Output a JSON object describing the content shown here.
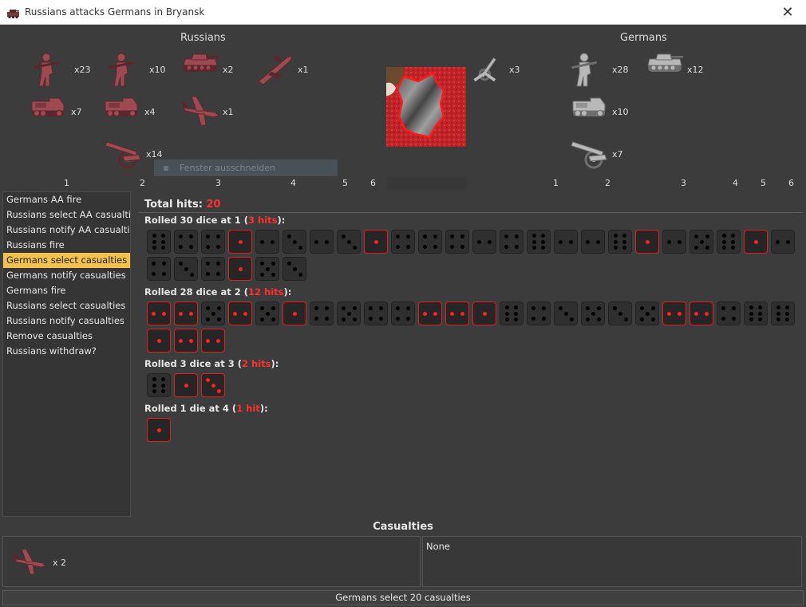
{
  "window": {
    "title": "Russians attacks Germans in Bryansk",
    "close_glyph": "✕"
  },
  "attacker": {
    "name": "Russians",
    "units": [
      {
        "icon": "infantry-icon",
        "count": "x23"
      },
      {
        "icon": "infantry-icon",
        "count": "x10"
      },
      {
        "icon": "tank-icon",
        "count": "x2"
      },
      {
        "icon": "bomber-icon",
        "count": "x1"
      },
      {
        "icon": "halftrack-icon",
        "count": "x7"
      },
      {
        "icon": "halftrack-icon",
        "count": "x4"
      },
      {
        "icon": "fighter-icon",
        "count": "x1"
      },
      {
        "icon": "artillery-icon",
        "count": "x14"
      }
    ],
    "axis": [
      "1",
      "2",
      "3",
      "4",
      "5",
      "6"
    ]
  },
  "defender": {
    "name": "Germans",
    "aa_unit": {
      "icon": "aa-gun-icon",
      "count": "x3"
    },
    "units": [
      {
        "icon": "infantry-icon",
        "count": "x28"
      },
      {
        "icon": "tank-icon",
        "count": "x12"
      },
      {
        "icon": "halftrack-icon",
        "count": "x10"
      },
      {
        "icon": "artillery-icon",
        "count": "x7"
      }
    ],
    "axis": [
      "1",
      "2",
      "3",
      "4",
      "5",
      "6"
    ]
  },
  "ghost_menu": "Fenster ausschneiden",
  "steps": [
    "Germans AA fire",
    "Russians select AA casualties",
    "Russians notify AA casualties",
    "Russians fire",
    "Germans select casualties",
    "Germans notify casualties",
    "Germans fire",
    "Russians select casualties",
    "Russians notify casualties",
    "Remove casualties",
    "Russians withdraw?"
  ],
  "selected_step": 4,
  "total": {
    "label": "Total hits:",
    "value": "20"
  },
  "rolls": [
    {
      "prefix": "Rolled 30 dice at 1 (",
      "hits": "3 hits",
      "suffix": "):",
      "threshold": 1,
      "dice": [
        6,
        4,
        4,
        1,
        2,
        3,
        2,
        3,
        1,
        4,
        4,
        4,
        2,
        4,
        6,
        2,
        2,
        6,
        1,
        2,
        5,
        6,
        1,
        2,
        4,
        3,
        4,
        1,
        5,
        3
      ]
    },
    {
      "prefix": "Rolled 28 dice at 2 (",
      "hits": "12 hits",
      "suffix": "):",
      "threshold": 2,
      "dice": [
        2,
        2,
        5,
        2,
        5,
        1,
        4,
        5,
        4,
        4,
        2,
        2,
        1,
        6,
        4,
        3,
        5,
        3,
        5,
        2,
        2,
        4,
        6,
        6,
        1,
        2,
        2
      ]
    },
    {
      "prefix": "Rolled 3 dice at 3 (",
      "hits": "2 hits",
      "suffix": "):",
      "threshold": 3,
      "dice": [
        6,
        1,
        3
      ]
    },
    {
      "prefix": "Rolled 1 die at 4 (",
      "hits": "1 hit",
      "suffix": "):",
      "threshold": 4,
      "dice": [
        1
      ]
    }
  ],
  "casualties": {
    "title": "Casualties",
    "left": {
      "icon": "fighter-icon",
      "count": "x 2"
    },
    "right": "None"
  },
  "bottom_button": "Germans select 20 casualties",
  "colors": {
    "russian": "#9e4a52",
    "german": "#b8b8b8",
    "hit": "#e02020",
    "selected": "#f2c14e"
  }
}
